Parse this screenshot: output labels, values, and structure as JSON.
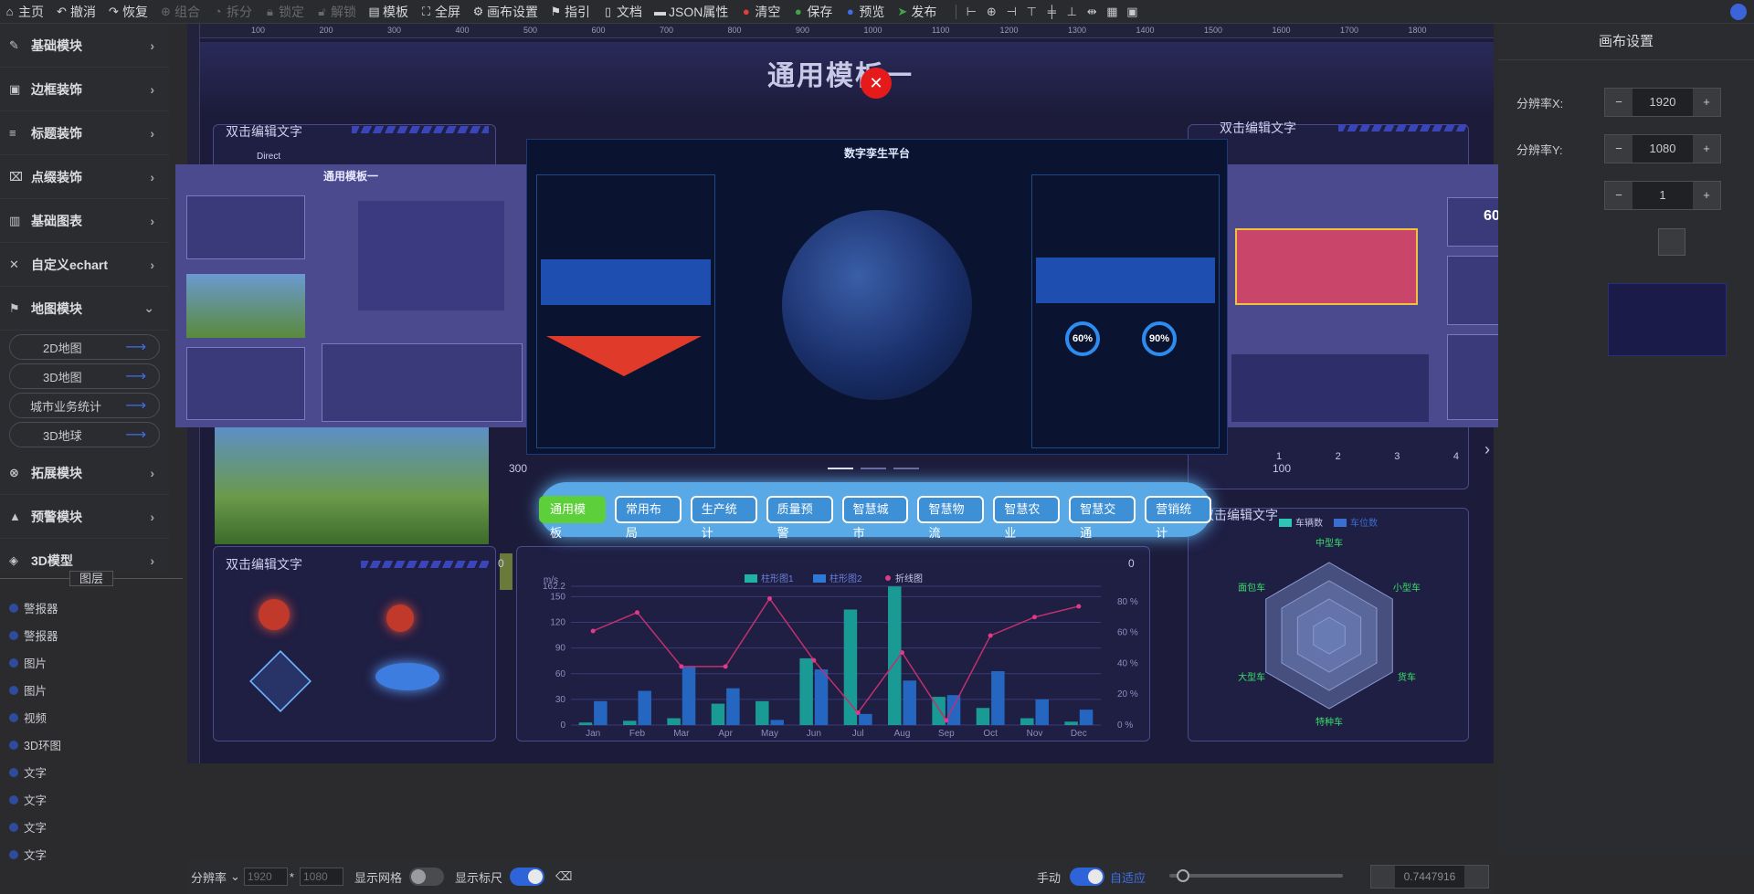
{
  "toolbar": {
    "items": [
      "主页",
      "撤消",
      "恢复",
      "组合",
      "拆分",
      "锁定",
      "解锁",
      "模板",
      "全屏",
      "画布设置",
      "指引",
      "文档",
      "JSON属性",
      "清空",
      "保存",
      "预览",
      "发布"
    ]
  },
  "sidebar": {
    "categories": [
      "基础模块",
      "边框装饰",
      "标题装饰",
      "点缀装饰",
      "基础图表",
      "自定义echart",
      "地图模块"
    ],
    "map_items": [
      "2D地图",
      "3D地图",
      "城市业务统计",
      "3D地球"
    ],
    "more_categories": [
      "拓展模块",
      "预警模块",
      "3D模型"
    ]
  },
  "layers": {
    "title": "图层",
    "items": [
      "警报器",
      "警报器",
      "图片",
      "图片",
      "视频",
      "3D环图",
      "文字",
      "文字",
      "文字",
      "文字"
    ]
  },
  "canvas": {
    "page_title": "通用模板一",
    "panel_title": "双击编辑文字",
    "direct": "Direct",
    "left_num": "300",
    "right_num": "100",
    "zero_left": "0",
    "zero_right": "0",
    "ruler_marks": [
      "100",
      "200",
      "300",
      "400",
      "500",
      "600",
      "700",
      "800",
      "900",
      "1000",
      "1100",
      "1200",
      "1300",
      "1400",
      "1500",
      "1600",
      "1700",
      "1800"
    ],
    "bottom_ticks": [
      "1",
      "2",
      "3",
      "4"
    ]
  },
  "preview": {
    "title": "数字孪生平台",
    "left_title": "通用模板一",
    "gauge1": "60%",
    "gauge2": "90%",
    "right_gauge": "60%"
  },
  "templates": {
    "buttons": [
      "通用模板",
      "常用布局",
      "生产统计",
      "质量预警",
      "智慧城市",
      "智慧物流",
      "智慧农业",
      "智慧交通",
      "营销统计"
    ],
    "active": 0
  },
  "chart_data": [
    {
      "type": "bar",
      "categories": [
        "Jan",
        "Feb",
        "Mar",
        "Apr",
        "May",
        "Jun",
        "Jul",
        "Aug",
        "Sep",
        "Oct",
        "Nov",
        "Dec"
      ],
      "series": [
        {
          "name": "柱形图1",
          "values": [
            3,
            5,
            8,
            25,
            28,
            78,
            135,
            162,
            33,
            20,
            8,
            4
          ]
        },
        {
          "name": "柱形图2",
          "values": [
            28,
            40,
            68,
            43,
            6,
            65,
            13,
            52,
            35,
            63,
            30,
            18
          ]
        },
        {
          "name": "折线图",
          "values": [
            61,
            73,
            38,
            38,
            82,
            42,
            8,
            47,
            3,
            58,
            70,
            77
          ]
        }
      ],
      "ylim": [
        0,
        162.2
      ],
      "yticks": [
        "0",
        "30",
        "60",
        "90",
        "120",
        "150",
        "162.2"
      ],
      "y2ticks": [
        "0 %",
        "20 %",
        "40 %",
        "60 %",
        "80 %"
      ],
      "ylabel": "m/s"
    },
    {
      "type": "radar",
      "categories": [
        "中型车",
        "小型车",
        "货车",
        "特种车",
        "大型车",
        "面包车"
      ],
      "series": [
        {
          "name": "车辆数"
        },
        {
          "name": "车位数"
        }
      ]
    }
  ],
  "right_panel": {
    "title": "画布设置",
    "rows": [
      {
        "label": "分辨率X:",
        "value": "1920"
      },
      {
        "label": "分辨率Y:",
        "value": "1080"
      },
      {
        "label": "",
        "value": "1"
      }
    ]
  },
  "bottombar": {
    "resolution": "分辨率",
    "x": "1920",
    "y": "1080",
    "grid": "显示网格",
    "ruler": "显示标尺",
    "manual": "手动",
    "auto": "自适应",
    "zoom": "0.7447916"
  },
  "colors": {
    "accent": "#3f6ee8",
    "active_template": "#5ccf3a",
    "close": "#e51b1b"
  }
}
